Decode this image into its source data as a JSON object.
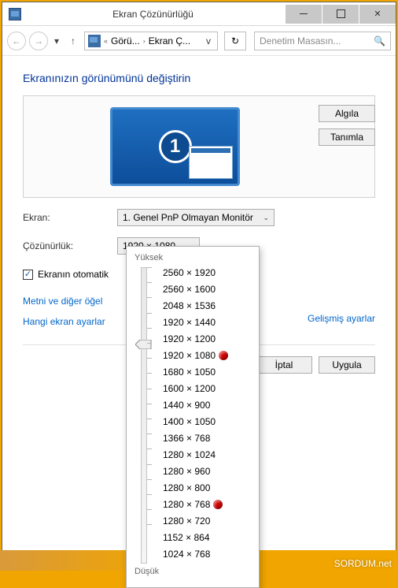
{
  "window": {
    "title": "Ekran Çözünürlüğü"
  },
  "titlebar_icon": "monitor-icon",
  "nav": {
    "crumb1": "Görü...",
    "crumb2": "Ekran Ç...",
    "search_placeholder": "Denetim Masasın..."
  },
  "heading": "Ekranınızın görünümünü değiştirin",
  "monitor_number": "1",
  "buttons": {
    "detect": "Algıla",
    "identify": "Tanımla",
    "cancel": "İptal",
    "apply": "Uygula"
  },
  "labels": {
    "screen": "Ekran:",
    "resolution": "Çözünürlük:"
  },
  "combos": {
    "screen_value": "1. Genel PnP Olmayan Monitör",
    "resolution_value": "1920 × 1080"
  },
  "checkbox": {
    "checked": true,
    "label": "Ekranın otomatik"
  },
  "advanced_link": "Gelişmiş ayarlar",
  "links": {
    "text_size": "Metni ve diğer öğel",
    "which_settings": "Hangi ekran ayarlar"
  },
  "popup": {
    "high": "Yüksek",
    "low": "Düşük",
    "resolutions": [
      {
        "label": "2560 × 1920",
        "dot": false
      },
      {
        "label": "2560 × 1600",
        "dot": false
      },
      {
        "label": "2048 × 1536",
        "dot": false
      },
      {
        "label": "1920 × 1440",
        "dot": false
      },
      {
        "label": "1920 × 1200",
        "dot": false
      },
      {
        "label": "1920 × 1080",
        "dot": true
      },
      {
        "label": "1680 × 1050",
        "dot": false
      },
      {
        "label": "1600 × 1200",
        "dot": false
      },
      {
        "label": "1440 × 900",
        "dot": false
      },
      {
        "label": "1400 × 1050",
        "dot": false
      },
      {
        "label": "1366 × 768",
        "dot": false
      },
      {
        "label": "1280 × 1024",
        "dot": false
      },
      {
        "label": "1280 × 960",
        "dot": false
      },
      {
        "label": "1280 × 800",
        "dot": false
      },
      {
        "label": "1280 × 768",
        "dot": true
      },
      {
        "label": "1280 × 720",
        "dot": false
      },
      {
        "label": "1152 × 864",
        "dot": false
      },
      {
        "label": "1024 × 768",
        "dot": false
      }
    ]
  },
  "brand": "SORDUM.net"
}
